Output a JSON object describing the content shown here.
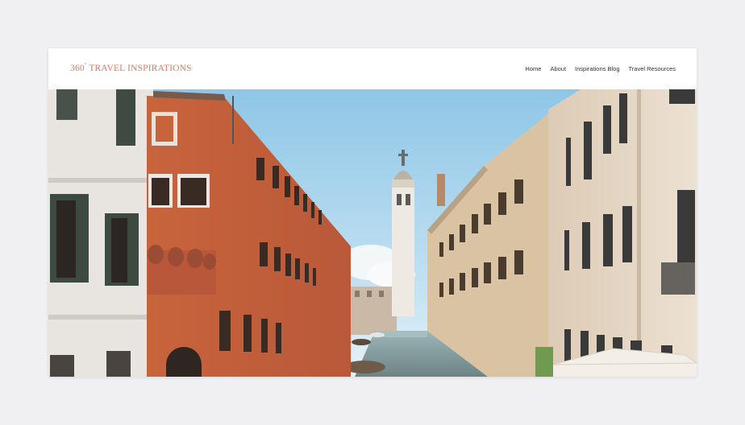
{
  "site": {
    "title_prefix": "360",
    "title_degree": "°",
    "title_rest": " TRAVEL INSPIRATIONS"
  },
  "nav": {
    "items": [
      "Home",
      "About",
      "Inspirations Blog",
      "Travel Resources"
    ]
  },
  "hero": {
    "image_subject": "venice-canal-photo"
  },
  "colors": {
    "accent": "#e07a5f",
    "nav_text": "#333333",
    "page_background": "#f0f0f2"
  }
}
